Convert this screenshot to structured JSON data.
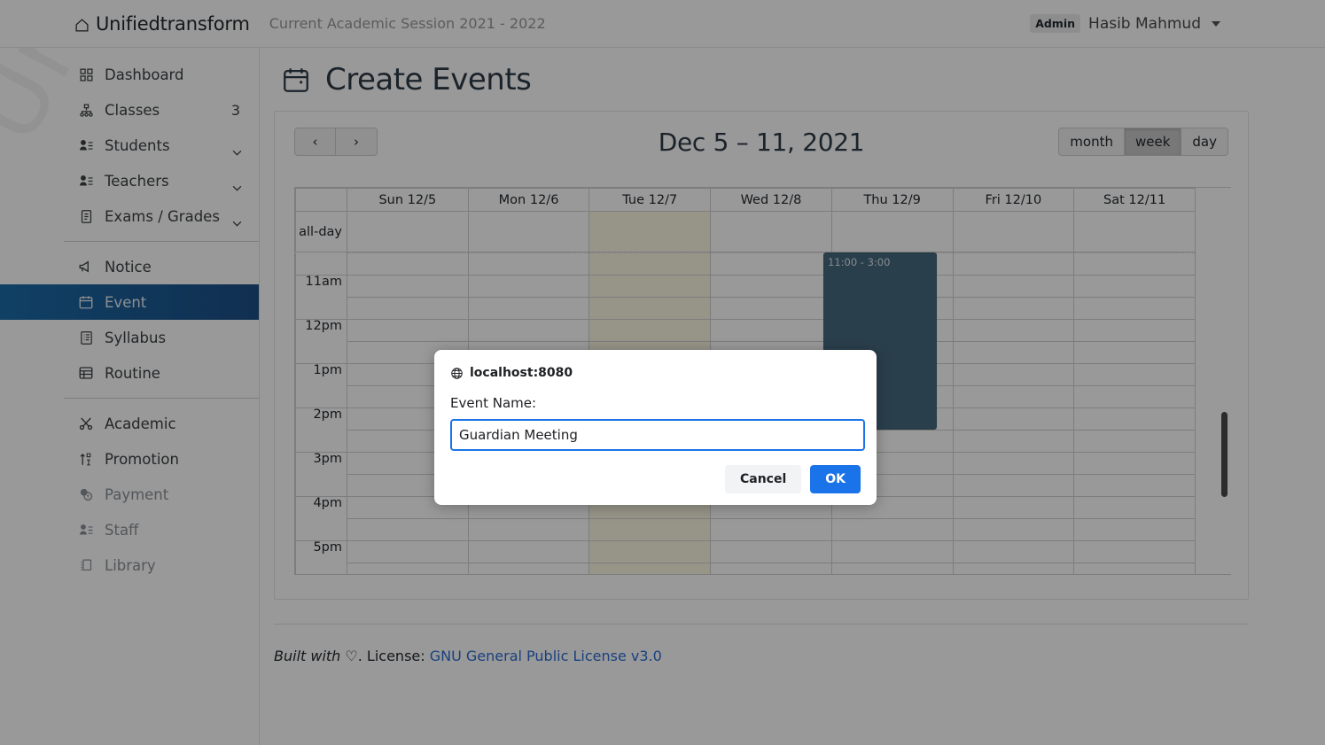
{
  "navbar": {
    "brand": "Unifiedtransform",
    "session": "Current Academic Session 2021 - 2022",
    "role_badge": "Admin",
    "user_name": "Hasib Mahmud"
  },
  "sidebar": {
    "items": [
      {
        "label": "Dashboard",
        "icon": "grid-icon",
        "trailing": "",
        "state": "normal"
      },
      {
        "label": "Classes",
        "icon": "sitemap-icon",
        "trailing": "3",
        "state": "normal"
      },
      {
        "label": "Students",
        "icon": "user-list-icon",
        "trailing": "chevron-down-icon",
        "state": "normal"
      },
      {
        "label": "Teachers",
        "icon": "user-list-icon",
        "trailing": "chevron-down-icon",
        "state": "normal"
      },
      {
        "label": "Exams / Grades",
        "icon": "document-icon",
        "trailing": "chevron-down-icon",
        "state": "normal"
      },
      {
        "label": "Notice",
        "icon": "megaphone-icon",
        "trailing": "",
        "state": "normal"
      },
      {
        "label": "Event",
        "icon": "calendar-icon",
        "trailing": "",
        "state": "active"
      },
      {
        "label": "Syllabus",
        "icon": "list-doc-icon",
        "trailing": "",
        "state": "normal"
      },
      {
        "label": "Routine",
        "icon": "schedule-icon",
        "trailing": "",
        "state": "normal"
      },
      {
        "label": "Academic",
        "icon": "scissors-icon",
        "trailing": "",
        "state": "normal"
      },
      {
        "label": "Promotion",
        "icon": "sort-up-icon",
        "trailing": "",
        "state": "normal"
      },
      {
        "label": "Payment",
        "icon": "coins-icon",
        "trailing": "",
        "state": "muted"
      },
      {
        "label": "Staff",
        "icon": "user-list-icon",
        "trailing": "",
        "state": "muted"
      },
      {
        "label": "Library",
        "icon": "books-icon",
        "trailing": "",
        "state": "muted"
      }
    ]
  },
  "page": {
    "title": "Create Events",
    "title_icon": "calendar-icon"
  },
  "calendar": {
    "prev_label": "‹",
    "next_label": "›",
    "title": "Dec 5 – 11, 2021",
    "views": [
      {
        "label": "month",
        "active": false
      },
      {
        "label": "week",
        "active": true
      },
      {
        "label": "day",
        "active": false
      }
    ],
    "allday_label": "all-day",
    "days": [
      {
        "label": "Sun 12/5",
        "today": false
      },
      {
        "label": "Mon 12/6",
        "today": false
      },
      {
        "label": "Tue 12/7",
        "today": true
      },
      {
        "label": "Wed 12/8",
        "today": false
      },
      {
        "label": "Thu 12/9",
        "today": false
      },
      {
        "label": "Fri 12/10",
        "today": false
      },
      {
        "label": "Sat 12/11",
        "today": false
      }
    ],
    "time_slots": [
      "11am",
      "12pm",
      "1pm",
      "2pm",
      "3pm",
      "4pm",
      "5pm"
    ],
    "events": [
      {
        "time_text": "11:00 - 3:00",
        "day": "Thu 12/9",
        "color": "#46697f"
      }
    ]
  },
  "footer": {
    "built_with": "Built with",
    "heart": "♡",
    "license_prefix": ". License:",
    "license_link": "GNU General Public License v3.0"
  },
  "dialog": {
    "origin": "localhost:8080",
    "origin_icon": "globe-icon",
    "label": "Event Name:",
    "input_value": "Guardian Meeting",
    "cancel_label": "Cancel",
    "ok_label": "OK",
    "accent_color": "#1a73e8"
  }
}
